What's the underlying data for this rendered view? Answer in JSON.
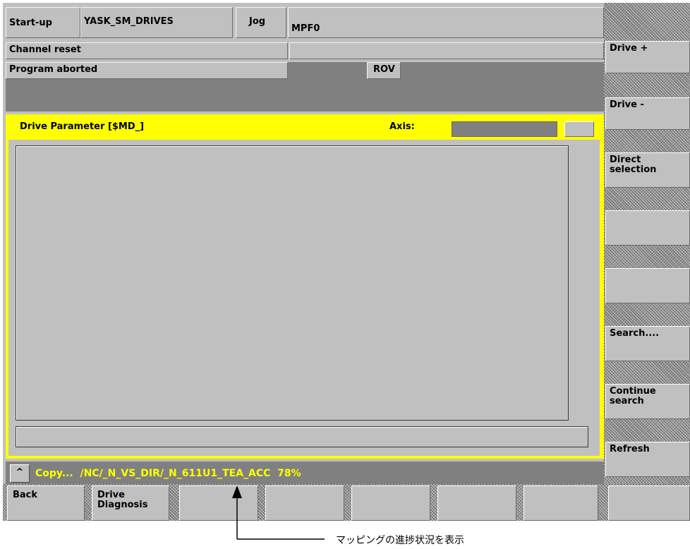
{
  "header": {
    "area": "Start-up",
    "machine": "YASK_SM_DRIVES",
    "mode": "Jog",
    "program": "MPF0",
    "channel_status": "Channel reset",
    "program_status": "Program aborted",
    "override_flag": "ROV"
  },
  "panel": {
    "title": "Drive Parameter [$MD_]",
    "axis_label": "Axis:",
    "axis_value": ""
  },
  "right_softkeys": [
    {
      "label": "Drive +"
    },
    {
      "label": "Drive -"
    },
    {
      "label": "Direct selection"
    },
    {
      "label": ""
    },
    {
      "label": ""
    },
    {
      "label": "Search...."
    },
    {
      "label": "Continue search"
    },
    {
      "label": "Refresh"
    }
  ],
  "status_line": {
    "recall_symbol": "^",
    "message": "Copy...  /NC/_N_VS_DIR/_N_611U1_TEA_ACC  78%",
    "progress_percent": 78
  },
  "bottom_softkeys": [
    {
      "label": "Back"
    },
    {
      "label": "Drive Diagnosis"
    },
    {
      "label": ""
    },
    {
      "label": ""
    },
    {
      "label": ""
    },
    {
      "label": ""
    },
    {
      "label": ""
    }
  ],
  "annotation": {
    "text": "マッピングの進捗状況を表示"
  },
  "colors": {
    "panel_yellow": "#ffff00",
    "status_text_yellow": "#ffff00",
    "screen_gray": "#c0c0c0",
    "dark_gray": "#808080"
  }
}
